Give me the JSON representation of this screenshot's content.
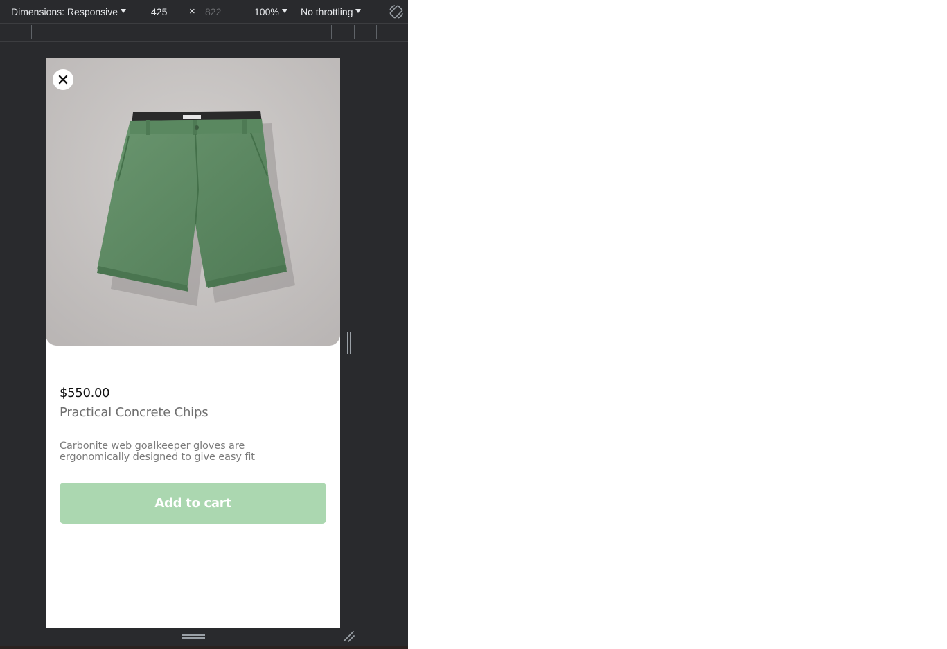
{
  "toolbar": {
    "dimensions_label": "Dimensions: Responsive",
    "width_value": "425",
    "separator": "×",
    "height_value": "822",
    "zoom_label": "100%",
    "throttling_label": "No throttling"
  },
  "product": {
    "price": "$550.00",
    "name": "Practical Concrete Chips",
    "description": "Carbonite web goalkeeper gloves are ergonomically designed to give easy fit",
    "add_to_cart_label": "Add to cart",
    "image_alt": "green shorts"
  },
  "colors": {
    "devtools_bg": "#292a2d",
    "image_bg": "#c8c5c4",
    "shorts_green": "#5e8a63",
    "button_bg": "#abd7b0",
    "button_text": "#ffffff",
    "price_text": "#111111",
    "name_text": "#6f6f6f"
  },
  "icons": {
    "close": "close-icon",
    "rotate": "rotate-icon",
    "dropdown": "chevron-down-icon",
    "resize_right": "resize-handle-icon",
    "resize_bottom": "resize-handle-icon",
    "resize_corner": "resize-corner-icon"
  }
}
